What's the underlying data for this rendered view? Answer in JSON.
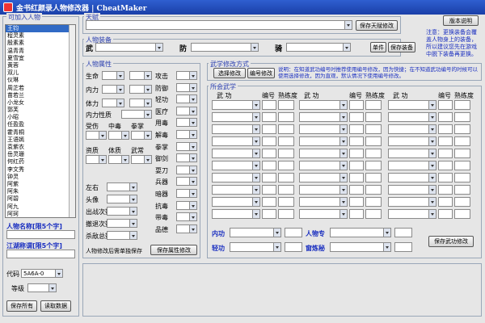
{
  "window": {
    "title": "金书红颜录人物修改器 | CheatMaker"
  },
  "left": {
    "legend": "可加入人物",
    "items": [
      "王钧",
      "程灵素",
      "殷素素",
      "温青青",
      "夏雪宜",
      "黄蓉",
      "双儿",
      "仪琳",
      "周芷若",
      "苗若兰",
      "小龙女",
      "郭芙",
      "小昭",
      "任盈盈",
      "霍青桐",
      "王语嫣",
      "袁紫衣",
      "岳灵珊",
      "何红药",
      "李文秀",
      "钟灵",
      "阿紫",
      "阿朱",
      "阿碧",
      "阿九",
      "阿珂",
      "曾柔",
      "方怡",
      "黄衫女"
    ],
    "name_hint": "人物名称[限5个字]",
    "nick_hint": "江湖称谓[限5个字]",
    "code_label": "代码",
    "code_value": "5A6A-0",
    "level_label": "等级",
    "save_all": "保存所有",
    "read_data": "读取数据"
  },
  "top": {
    "legend": "天赋",
    "save_talent": "保存天赋修改",
    "about": "版本说明"
  },
  "equip": {
    "legend": "人物装备",
    "weapon": "武",
    "armor": "防",
    "horse": "骑",
    "single": "单件",
    "save": "保存装备",
    "note": "注意：更换装备会覆盖人物身上的装备，所以建议您先在游戏中脱下装备再更换。"
  },
  "attr": {
    "legend": "人物属性",
    "rows_a": [
      "生命",
      "内力",
      "体力"
    ],
    "inner_nature": "内力性质",
    "rows_b": [
      "受伤",
      "中毒",
      "拳掌"
    ],
    "rows_c": [
      "资质",
      "体质",
      "武常"
    ],
    "extra": [
      "左右",
      "头像",
      "出战次数",
      "撤退次数",
      "杀敌总数"
    ],
    "right": [
      "攻击",
      "防御",
      "轻功",
      "医疗",
      "用毒",
      "解毒",
      "拳掌",
      "御剑",
      "耍刀",
      "兵器",
      "暗器",
      "抗毒",
      "带毒",
      "品德"
    ],
    "note": "人物修改后需单独保存",
    "save": "保存属性修改"
  },
  "skillmode": {
    "legend": "武学修改方式",
    "by_select": "选择修改",
    "by_code": "编号修改",
    "note": "说明：在知道武功编号时推荐使用编号修改，因为快捷；在不知道武功编号的时候可以使用选择修改，因为直观，默认情况下使用编号修改。"
  },
  "skills": {
    "legend": "所会武学",
    "headers": [
      "武 功",
      "编号",
      "熟练度"
    ],
    "inner": "内功",
    "light": "轻功",
    "special": "人物专",
    "book": "窗炼秘",
    "save": "保存武功修改"
  }
}
